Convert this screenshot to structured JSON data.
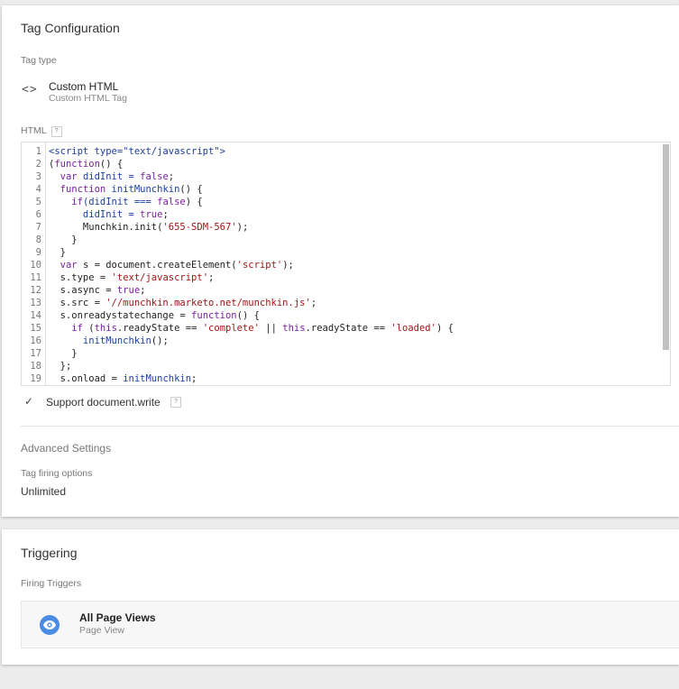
{
  "tag_configuration": {
    "title": "Tag Configuration",
    "tag_type_label": "Tag type",
    "tag_type": {
      "icon": "code-brackets-icon",
      "name": "Custom HTML",
      "description": "Custom HTML Tag"
    },
    "html_label": "HTML",
    "help_glyph": "?",
    "code_lines": [
      {
        "n": "1",
        "segs": [
          {
            "t": "<script type=\"text/javascript\">",
            "c": "fn"
          }
        ]
      },
      {
        "n": "2",
        "segs": [
          {
            "t": "(",
            "c": ""
          },
          {
            "t": "function",
            "c": "kw"
          },
          {
            "t": "() {",
            "c": ""
          }
        ]
      },
      {
        "n": "3",
        "segs": [
          {
            "t": "  ",
            "c": ""
          },
          {
            "t": "var",
            "c": "kw"
          },
          {
            "t": " didInit = ",
            "c": "fn"
          },
          {
            "t": "false",
            "c": "kw"
          },
          {
            "t": ";",
            "c": ""
          }
        ]
      },
      {
        "n": "4",
        "segs": [
          {
            "t": "  ",
            "c": ""
          },
          {
            "t": "function",
            "c": "kw"
          },
          {
            "t": " initMunchkin",
            "c": "fn"
          },
          {
            "t": "() {",
            "c": ""
          }
        ]
      },
      {
        "n": "5",
        "segs": [
          {
            "t": "    ",
            "c": ""
          },
          {
            "t": "if",
            "c": "kw"
          },
          {
            "t": "(didInit === ",
            "c": "fn"
          },
          {
            "t": "false",
            "c": "kw"
          },
          {
            "t": ") {",
            "c": ""
          }
        ]
      },
      {
        "n": "6",
        "segs": [
          {
            "t": "      didInit = ",
            "c": "fn"
          },
          {
            "t": "true",
            "c": "kw"
          },
          {
            "t": ";",
            "c": ""
          }
        ]
      },
      {
        "n": "7",
        "segs": [
          {
            "t": "      Munchkin.init(",
            "c": ""
          },
          {
            "t": "'655-SDM-567'",
            "c": "str"
          },
          {
            "t": ");",
            "c": ""
          }
        ]
      },
      {
        "n": "8",
        "segs": [
          {
            "t": "    }",
            "c": ""
          }
        ]
      },
      {
        "n": "9",
        "segs": [
          {
            "t": "  }",
            "c": ""
          }
        ]
      },
      {
        "n": "10",
        "segs": [
          {
            "t": "  ",
            "c": ""
          },
          {
            "t": "var",
            "c": "kw"
          },
          {
            "t": " s = document.createElement(",
            "c": ""
          },
          {
            "t": "'script'",
            "c": "str"
          },
          {
            "t": ");",
            "c": ""
          }
        ]
      },
      {
        "n": "11",
        "segs": [
          {
            "t": "  s.type = ",
            "c": ""
          },
          {
            "t": "'text/javascript'",
            "c": "str"
          },
          {
            "t": ";",
            "c": ""
          }
        ]
      },
      {
        "n": "12",
        "segs": [
          {
            "t": "  s.async = ",
            "c": ""
          },
          {
            "t": "true",
            "c": "kw"
          },
          {
            "t": ";",
            "c": ""
          }
        ]
      },
      {
        "n": "13",
        "segs": [
          {
            "t": "  s.src = ",
            "c": ""
          },
          {
            "t": "'//munchkin.marketo.net/munchkin.js'",
            "c": "str"
          },
          {
            "t": ";",
            "c": ""
          }
        ]
      },
      {
        "n": "14",
        "segs": [
          {
            "t": "  s.onreadystatechange = ",
            "c": ""
          },
          {
            "t": "function",
            "c": "kw"
          },
          {
            "t": "() {",
            "c": ""
          }
        ]
      },
      {
        "n": "15",
        "segs": [
          {
            "t": "    ",
            "c": ""
          },
          {
            "t": "if",
            "c": "kw"
          },
          {
            "t": " (",
            "c": ""
          },
          {
            "t": "this",
            "c": "kw"
          },
          {
            "t": ".readyState == ",
            "c": ""
          },
          {
            "t": "'complete'",
            "c": "str"
          },
          {
            "t": " || ",
            "c": ""
          },
          {
            "t": "this",
            "c": "kw"
          },
          {
            "t": ".readyState == ",
            "c": ""
          },
          {
            "t": "'loaded'",
            "c": "str"
          },
          {
            "t": ") {",
            "c": ""
          }
        ]
      },
      {
        "n": "16",
        "segs": [
          {
            "t": "      initMunchkin",
            "c": "fn"
          },
          {
            "t": "();",
            "c": ""
          }
        ]
      },
      {
        "n": "17",
        "segs": [
          {
            "t": "    }",
            "c": ""
          }
        ]
      },
      {
        "n": "18",
        "segs": [
          {
            "t": "  };",
            "c": ""
          }
        ]
      },
      {
        "n": "19",
        "segs": [
          {
            "t": "  s.onload = ",
            "c": ""
          },
          {
            "t": "initMunchkin",
            "c": "fn"
          },
          {
            "t": ";",
            "c": ""
          }
        ]
      }
    ],
    "support_document_write": {
      "checked": true,
      "label": "Support document.write"
    },
    "advanced_settings_label": "Advanced Settings",
    "tag_firing_options_label": "Tag firing options",
    "tag_firing_options_value": "Unlimited"
  },
  "triggering": {
    "title": "Triggering",
    "firing_triggers_label": "Firing Triggers",
    "trigger": {
      "icon": "eye-icon",
      "name": "All Page Views",
      "type": "Page View",
      "icon_color": "#4a8be3"
    }
  }
}
